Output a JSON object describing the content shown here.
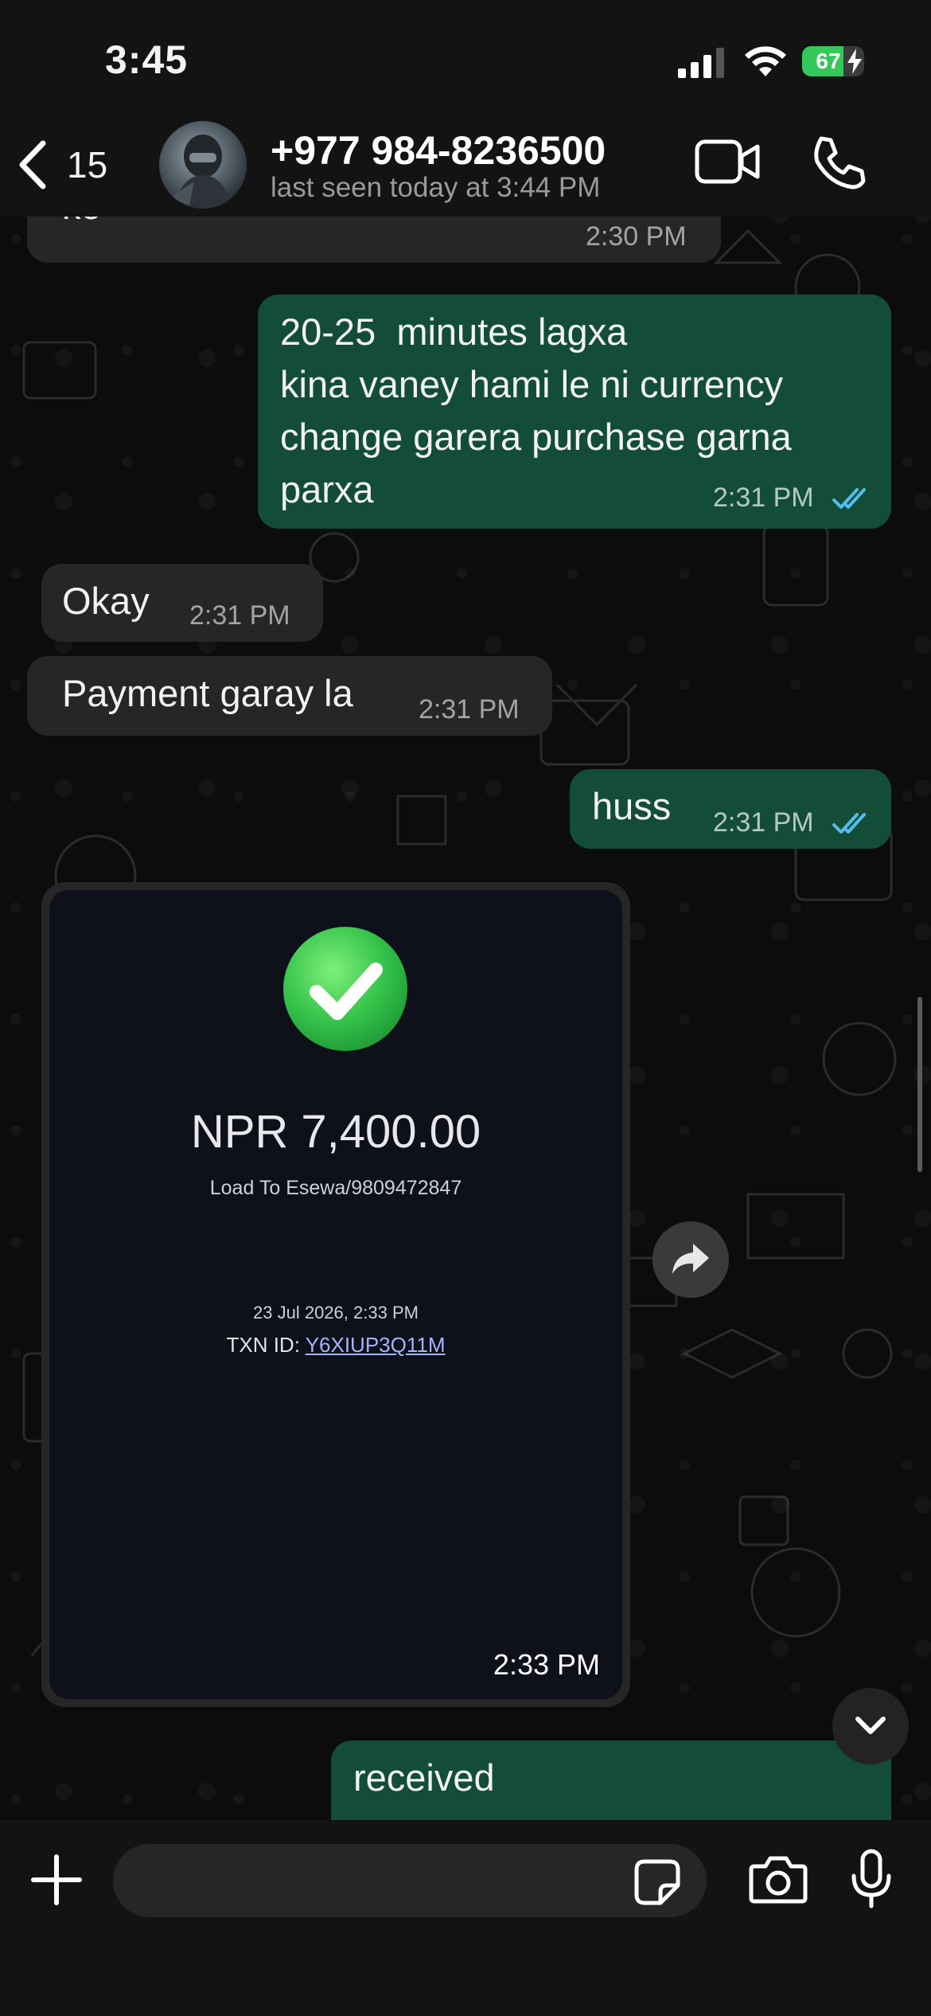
{
  "status_bar": {
    "time": "3:45",
    "battery_level": "67",
    "battery_fill_percent": 67,
    "signal_icon": "cellular-signal-icon",
    "wifi_icon": "wifi-icon"
  },
  "header": {
    "back_count": "15",
    "contact_name": "+977 984-8236500",
    "last_seen": "last seen today at 3:44 PM",
    "icons": [
      "back-chevron-icon",
      "video-camera-icon",
      "phone-icon"
    ]
  },
  "messages": [
    {
      "direction": "incoming",
      "text": "ko",
      "time": "2:30 PM"
    },
    {
      "direction": "outgoing",
      "text": "20-25  minutes lagxa\nkina vaney hami le ni currency\nchange garera purchase garna\nparxa",
      "time": "2:31 PM",
      "status": "read"
    },
    {
      "direction": "incoming",
      "text": "Okay",
      "time": "2:31 PM"
    },
    {
      "direction": "incoming",
      "text": "Payment garay la",
      "time": "2:31 PM"
    },
    {
      "direction": "outgoing",
      "text": "huss",
      "time": "2:31 PM",
      "status": "read"
    },
    {
      "direction": "incoming",
      "type": "image",
      "time": "2:33 PM",
      "receipt": {
        "amount": "NPR 7,400.00",
        "description": "Load To Esewa/9809472847",
        "date": "23 Jul 2026, 2:33 PM",
        "txn_label": "TXN ID: ",
        "txn_id": "Y6XIUP3Q11M"
      }
    },
    {
      "direction": "outgoing",
      "text": "received"
    }
  ],
  "composer": {
    "placeholder": "",
    "icons": [
      "plus-icon",
      "sticker-icon",
      "camera-icon",
      "microphone-icon"
    ]
  },
  "colors": {
    "outgoing_bubble": "#134d37",
    "incoming_bubble": "#262626",
    "read_ticks": "#53bdeb",
    "battery_green": "#34c759"
  }
}
